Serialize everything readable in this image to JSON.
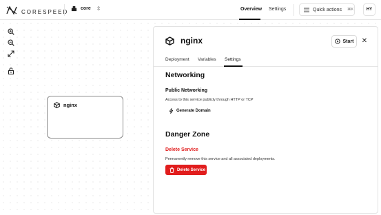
{
  "header": {
    "brand": "CORESPEED",
    "project": "core",
    "nav": [
      "Overview",
      "Settings"
    ],
    "active_nav": "Overview",
    "quick_actions": {
      "label": "Quick actions",
      "shortcut": "⌘K"
    },
    "user_initials": "HY"
  },
  "canvas": {
    "tools": [
      "zoom-in-icon",
      "zoom-out-icon",
      "fit-view-icon",
      "lock-icon"
    ],
    "node": {
      "name": "nginx",
      "icon": "cube-icon"
    }
  },
  "panel": {
    "service_name": "nginx",
    "start_label": "Start",
    "close_label": "✕",
    "tabs": [
      "Deployment",
      "Variables",
      "Settings"
    ],
    "active_tab": "Settings",
    "networking": {
      "title": "Networking",
      "public_title": "Public Networking",
      "public_desc": "Access to this service publicly through HTTP or TCP",
      "generate_label": "Generate Domain"
    },
    "danger": {
      "title": "Danger Zone",
      "delete_title": "Delete Service",
      "delete_desc": "Permanently remove this service and all associated deployments.",
      "delete_button": "Delete Service"
    }
  },
  "colors": {
    "danger": "#e11d1d",
    "text": "#111111",
    "border": "#e2e2e2"
  }
}
